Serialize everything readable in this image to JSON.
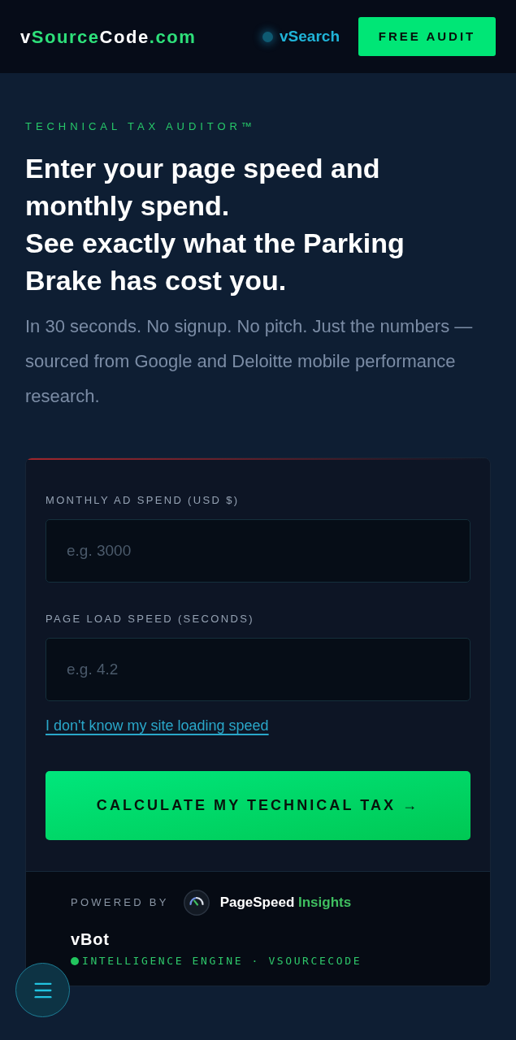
{
  "header": {
    "logo": [
      {
        "text": "v",
        "accent": false
      },
      {
        "text": "Source",
        "accent": true
      },
      {
        "text": "Code",
        "accent": false
      },
      {
        "text": ".com",
        "accent": true
      }
    ],
    "search_link": "vSearch",
    "cta_button": "FREE AUDIT"
  },
  "hero": {
    "eyebrow": "TECHNICAL TAX AUDITOR™",
    "headline": [
      "Enter your page speed and monthly spend.",
      "See exactly what the Parking Brake has cost you."
    ],
    "subtext": "In 30 seconds. No signup. No pitch. Just the numbers — sourced from Google and Deloitte mobile performance research."
  },
  "form": {
    "fields": [
      {
        "label": "MONTHLY AD SPEND (USD $)",
        "placeholder": "e.g. 3000"
      },
      {
        "label": "PAGE LOAD SPEED (SECONDS)",
        "placeholder": "e.g. 4.2"
      }
    ],
    "help_link": "I don't know my site loading speed",
    "submit_button": "CALCULATE MY TECHNICAL TAX →"
  },
  "footer": {
    "powered_by": "POWERED BY",
    "product": {
      "name": "PageSpeed",
      "accent": "Insights"
    },
    "bot_name": "vBot",
    "bot_tagline": "INTELLIGENCE ENGINE · VSOURCECODE"
  }
}
